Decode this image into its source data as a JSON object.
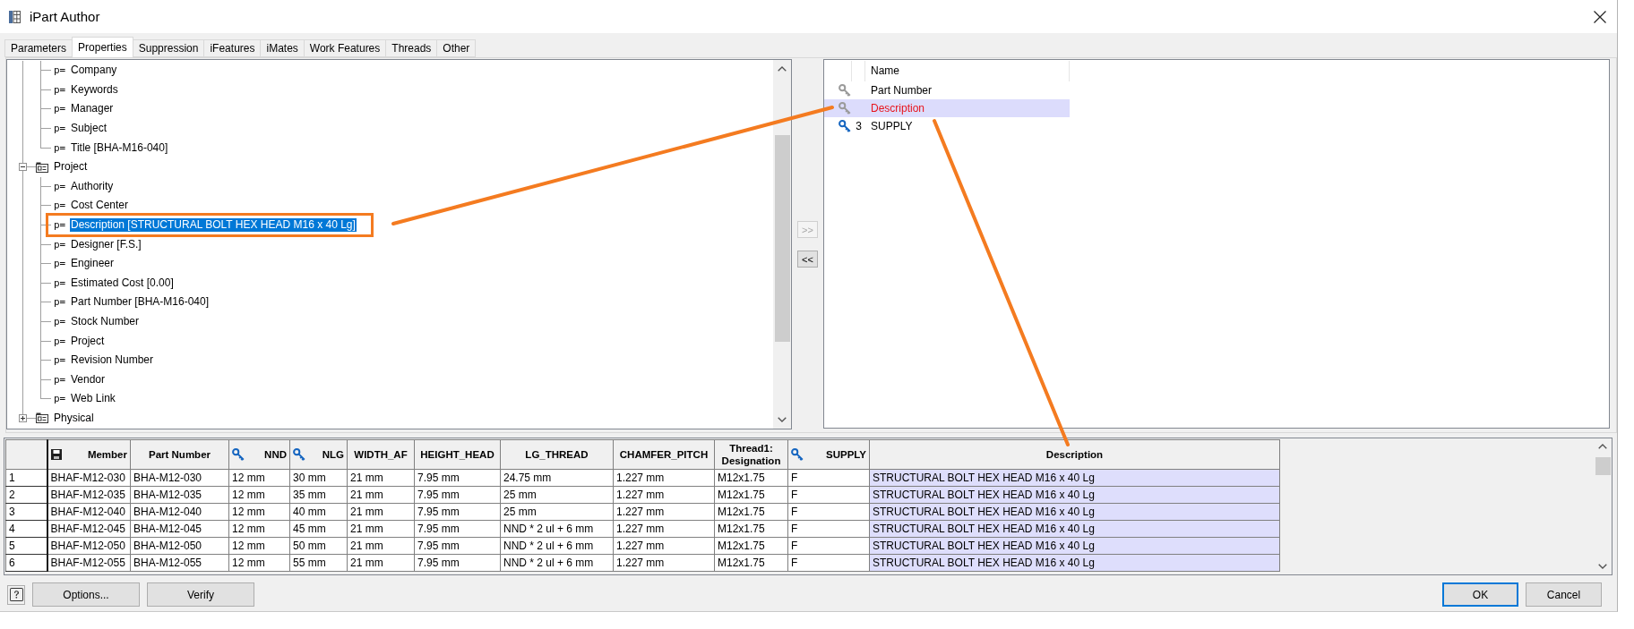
{
  "window": {
    "title": "iPart Author"
  },
  "tabs": [
    {
      "label": "Parameters",
      "selected": false
    },
    {
      "label": "Properties",
      "selected": true
    },
    {
      "label": "Suppression",
      "selected": false
    },
    {
      "label": "iFeatures",
      "selected": false
    },
    {
      "label": "iMates",
      "selected": false
    },
    {
      "label": "Work Features",
      "selected": false
    },
    {
      "label": "Threads",
      "selected": false
    },
    {
      "label": "Other",
      "selected": false
    }
  ],
  "tree": {
    "items": [
      {
        "kind": "group",
        "children": [
          {
            "kind": "property",
            "marker": "p=",
            "label": "Company",
            "selected": false,
            "outlined": false
          },
          {
            "kind": "property",
            "marker": "p=",
            "label": "Keywords",
            "selected": false,
            "outlined": false
          },
          {
            "kind": "property",
            "marker": "p=",
            "label": "Manager",
            "selected": false,
            "outlined": false
          },
          {
            "kind": "property",
            "marker": "p=",
            "label": "Subject",
            "selected": false,
            "outlined": false
          },
          {
            "kind": "property",
            "marker": "p=",
            "label": "Title [BHA-M16-040]",
            "selected": false,
            "outlined": false
          }
        ]
      },
      {
        "kind": "group",
        "label": "Project",
        "expanded": true,
        "selected": false,
        "children": [
          {
            "kind": "property",
            "marker": "p=",
            "label": "Authority",
            "selected": false,
            "outlined": false
          },
          {
            "kind": "property",
            "marker": "p=",
            "label": "Cost Center",
            "selected": false,
            "outlined": false
          },
          {
            "kind": "property",
            "marker": "p=",
            "label": "Description [STRUCTURAL BOLT HEX HEAD M16 x 40 Lg]",
            "selected": true,
            "outlined": true
          },
          {
            "kind": "property",
            "marker": "p=",
            "label": "Designer [F.S.]",
            "selected": false,
            "outlined": false
          },
          {
            "kind": "property",
            "marker": "p=",
            "label": "Engineer",
            "selected": false,
            "outlined": false
          },
          {
            "kind": "property",
            "marker": "p=",
            "label": "Estimated Cost [0.00]",
            "selected": false,
            "outlined": false
          },
          {
            "kind": "property",
            "marker": "p=",
            "label": "Part Number [BHA-M16-040]",
            "selected": false,
            "outlined": false
          },
          {
            "kind": "property",
            "marker": "p=",
            "label": "Stock Number",
            "selected": false,
            "outlined": false
          },
          {
            "kind": "property",
            "marker": "p=",
            "label": "Project",
            "selected": false,
            "outlined": false
          },
          {
            "kind": "property",
            "marker": "p=",
            "label": "Revision Number",
            "selected": false,
            "outlined": false
          },
          {
            "kind": "property",
            "marker": "p=",
            "label": "Vendor",
            "selected": false,
            "outlined": false
          },
          {
            "kind": "property",
            "marker": "p=",
            "label": "Web Link",
            "selected": false,
            "outlined": false
          }
        ]
      },
      {
        "kind": "group",
        "label": "Physical",
        "expanded": false,
        "selected": false
      }
    ]
  },
  "transfer_buttons": [
    {
      "label": ">>",
      "disabled": true
    },
    {
      "label": "<<",
      "disabled": false
    }
  ],
  "key_list": {
    "header": "Name",
    "rows": [
      {
        "key": false,
        "label": "Part Number",
        "selected": false
      },
      {
        "key": false,
        "label": "Description",
        "selected": true
      },
      {
        "key": true,
        "key_number": "3",
        "label": "SUPPLY",
        "selected": false
      }
    ]
  },
  "table": {
    "columns": [
      {
        "kind": "member",
        "label": "Member",
        "selected": false
      },
      {
        "kind": "plain",
        "label": "Part Number",
        "selected": false
      },
      {
        "kind": "key",
        "label": "NND",
        "selected": false
      },
      {
        "kind": "key",
        "label": "NLG",
        "selected": false
      },
      {
        "kind": "plain",
        "label": "WIDTH_AF",
        "selected": false
      },
      {
        "kind": "plain",
        "label": "HEIGHT_HEAD",
        "selected": false
      },
      {
        "kind": "plain",
        "label": "LG_THREAD",
        "selected": false
      },
      {
        "kind": "plain",
        "label": "CHAMFER_PITCH",
        "selected": false
      },
      {
        "kind": "plain",
        "label": "Thread1: Designation",
        "selected": false
      },
      {
        "kind": "key",
        "label": "SUPPLY",
        "selected": false
      },
      {
        "kind": "plain",
        "label": "Description",
        "selected": true
      }
    ],
    "rows": [
      {
        "number": "1",
        "cells": [
          "BHAF-M12-030",
          "BHA-M12-030",
          "12 mm",
          "30 mm",
          "21 mm",
          "7.95 mm",
          "24.75 mm",
          "1.227 mm",
          "M12x1.75",
          "F",
          "STRUCTURAL BOLT HEX HEAD M16 x 40 Lg"
        ]
      },
      {
        "number": "2",
        "cells": [
          "BHAF-M12-035",
          "BHA-M12-035",
          "12 mm",
          "35 mm",
          "21 mm",
          "7.95 mm",
          "25 mm",
          "1.227 mm",
          "M12x1.75",
          "F",
          "STRUCTURAL BOLT HEX HEAD M16 x 40 Lg"
        ]
      },
      {
        "number": "3",
        "cells": [
          "BHAF-M12-040",
          "BHA-M12-040",
          "12 mm",
          "40 mm",
          "21 mm",
          "7.95 mm",
          "25 mm",
          "1.227 mm",
          "M12x1.75",
          "F",
          "STRUCTURAL BOLT HEX HEAD M16 x 40 Lg"
        ]
      },
      {
        "number": "4",
        "cells": [
          "BHAF-M12-045",
          "BHA-M12-045",
          "12 mm",
          "45 mm",
          "21 mm",
          "7.95 mm",
          "NND * 2 ul + 6 mm",
          "1.227 mm",
          "M12x1.75",
          "F",
          "STRUCTURAL BOLT HEX HEAD M16 x 40 Lg"
        ]
      },
      {
        "number": "5",
        "cells": [
          "BHAF-M12-050",
          "BHA-M12-050",
          "12 mm",
          "50 mm",
          "21 mm",
          "7.95 mm",
          "NND * 2 ul + 6 mm",
          "1.227 mm",
          "M12x1.75",
          "F",
          "STRUCTURAL BOLT HEX HEAD M16 x 40 Lg"
        ]
      },
      {
        "number": "6",
        "cells": [
          "BHAF-M12-055",
          "BHA-M12-055",
          "12 mm",
          "55 mm",
          "21 mm",
          "7.95 mm",
          "NND * 2 ul + 6 mm",
          "1.227 mm",
          "M12x1.75",
          "F",
          "STRUCTURAL BOLT HEX HEAD M16 x 40 Lg"
        ]
      }
    ]
  },
  "buttons": [
    {
      "label": "Options..."
    },
    {
      "label": "Verify"
    }
  ],
  "dialog_buttons": [
    {
      "label": "OK",
      "default": true
    },
    {
      "label": "Cancel",
      "default": false
    }
  ],
  "callouts": {
    "visible": true
  }
}
